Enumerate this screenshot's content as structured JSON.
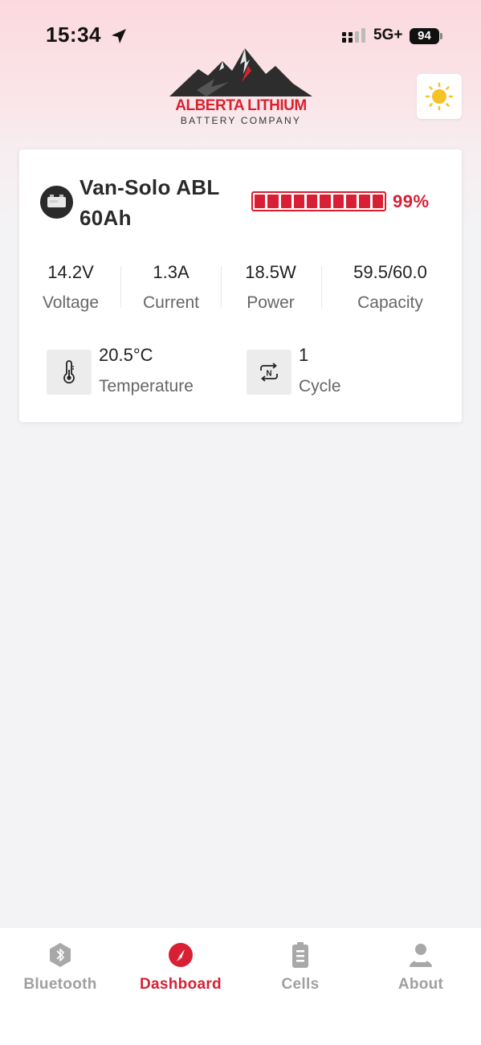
{
  "status_bar": {
    "time": "15:34",
    "network": "5G+",
    "battery_level": "94"
  },
  "header": {
    "logo_line1": "ALBERTA LITHIUM",
    "logo_line2": "BATTERY COMPANY",
    "theme_icon": "sun-icon"
  },
  "device": {
    "name": "Van-Solo ABL 60Ah",
    "battery_percent": "99%",
    "battery_fraction": 0.99,
    "accent_color": "#d81f33",
    "stats": [
      {
        "value": "14.2V",
        "label": "Voltage"
      },
      {
        "value": "1.3A",
        "label": "Current"
      },
      {
        "value": "18.5W",
        "label": "Power"
      },
      {
        "value": "59.5/60.0",
        "label": "Capacity"
      }
    ],
    "temperature": {
      "value": "20.5°C",
      "label": "Temperature",
      "icon": "thermometer-icon"
    },
    "cycle": {
      "value": "1",
      "label": "Cycle",
      "icon": "cycle-icon"
    }
  },
  "tabs": [
    {
      "label": "Bluetooth",
      "icon": "bluetooth-icon",
      "active": false
    },
    {
      "label": "Dashboard",
      "icon": "dashboard-icon",
      "active": true
    },
    {
      "label": "Cells",
      "icon": "cells-icon",
      "active": false
    },
    {
      "label": "About",
      "icon": "about-icon",
      "active": false
    }
  ]
}
